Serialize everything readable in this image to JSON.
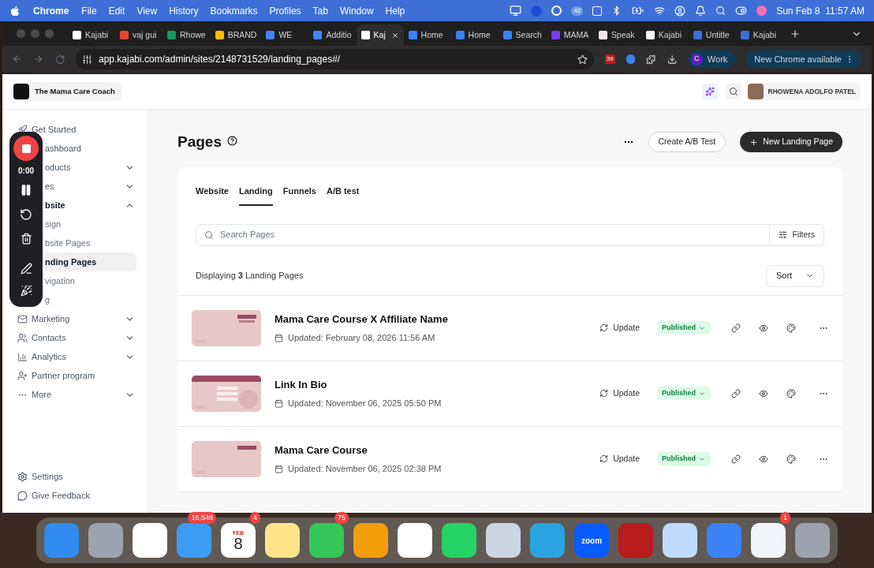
{
  "menu_bar": {
    "app": "Chrome",
    "items": [
      "File",
      "Edit",
      "View",
      "History",
      "Bookmarks",
      "Profiles",
      "Tab",
      "Window",
      "Help"
    ],
    "status_badge": "42",
    "clock": "Sun Feb 8  11:57 AM"
  },
  "browser": {
    "tabs": [
      {
        "label": "Kajabi",
        "color": "#ffffff",
        "selected": false
      },
      {
        "label": "vaj gui",
        "color": "#ea4335",
        "selected": false
      },
      {
        "label": "Rhowe",
        "color": "#0f9d58",
        "selected": false
      },
      {
        "label": "BRAND",
        "color": "#fbbc04",
        "selected": false
      },
      {
        "label": "WE",
        "color": "#4285f4",
        "selected": false
      },
      {
        "label": "Additio",
        "color": "#4285f4",
        "selected": false
      },
      {
        "label": "Kaj",
        "color": "#ffffff",
        "selected": true
      },
      {
        "label": "Home",
        "color": "#3b82f6",
        "selected": false
      },
      {
        "label": "Home",
        "color": "#3b82f6",
        "selected": false
      },
      {
        "label": "Search",
        "color": "#3b82f6",
        "selected": false
      },
      {
        "label": "MAMA",
        "color": "#7c3aed",
        "selected": false
      },
      {
        "label": "Speak",
        "color": "#f3e8e8",
        "selected": false
      },
      {
        "label": "Kajabi",
        "color": "#ffffff",
        "selected": false
      },
      {
        "label": "Untitle",
        "color": "#3b6fd8",
        "selected": false
      },
      {
        "label": "Kajabi",
        "color": "#3b6fd8",
        "selected": false
      }
    ],
    "url": "app.kajabi.com/admin/sites/2148731529/landing_pages#/",
    "extension_badge": "39",
    "profile_initial": "C",
    "profile": "Work",
    "update_notice": "New Chrome available"
  },
  "app": {
    "site_name": "The Mama Care Coach",
    "user": "RHOWENA ADOLFO PATEL",
    "sidebar": {
      "items": [
        {
          "label": "Get Started",
          "kind": "full"
        },
        {
          "label": "ashboard",
          "kind": "covered"
        },
        {
          "label": "oducts",
          "kind": "covered",
          "expanded": false
        },
        {
          "label": "es",
          "kind": "covered",
          "expanded": false
        },
        {
          "label": "bsite",
          "kind": "covered",
          "expanded": true,
          "children": [
            {
              "label": "sign",
              "selected": false
            },
            {
              "label": "bsite Pages",
              "selected": false
            },
            {
              "label": "nding Pages",
              "selected": true
            },
            {
              "label": "vigation",
              "selected": false
            },
            {
              "label": "g",
              "selected": false
            }
          ]
        },
        {
          "label": "Marketing",
          "kind": "full",
          "expanded": false
        },
        {
          "label": "Contacts",
          "kind": "full",
          "expanded": false
        },
        {
          "label": "Analytics",
          "kind": "full",
          "expanded": false
        },
        {
          "label": "Partner program",
          "kind": "full"
        },
        {
          "label": "More",
          "kind": "full",
          "expanded": false
        }
      ],
      "footer": [
        "Settings",
        "Give Feedback"
      ]
    },
    "recorder": {
      "time": "0:00"
    },
    "page": {
      "title": "Pages",
      "buttons": {
        "ab_test": "Create A/B Test",
        "new": "New Landing Page"
      },
      "tabs": [
        {
          "label": "Website",
          "selected": false
        },
        {
          "label": "Landing",
          "selected": true
        },
        {
          "label": "Funnels",
          "selected": false
        },
        {
          "label": "A/B test",
          "selected": false
        }
      ],
      "search": {
        "placeholder": "Search Pages"
      },
      "filters": "Filters",
      "count": "Displaying **3** Landing Pages",
      "sort": "Sort",
      "rows": [
        {
          "title": "Mama Care Course X Affiliate Name",
          "updated": "Updated: February 08, 2026 11:56 AM",
          "action": "Update",
          "status": "Published"
        },
        {
          "title": "Link In Bio",
          "updated": "Updated: November 06, 2025 05:50 PM",
          "action": "Update",
          "status": "Published"
        },
        {
          "title": "Mama Care Course",
          "updated": "Updated: November 06, 2025 02:38 PM",
          "action": "Update",
          "status": "Published"
        }
      ]
    }
  },
  "dock": [
    {
      "color": "#2f8cf0"
    },
    {
      "color": "#9ca3af"
    },
    {
      "color": "#ffffff"
    },
    {
      "color": "#3b9cf5",
      "badge": "15,548"
    },
    {
      "color": "#ffffff",
      "badge": "4",
      "month": "FEB",
      "day": "8"
    },
    {
      "color": "#fde68a"
    },
    {
      "color": "#34c759",
      "badge": "75"
    },
    {
      "color": "#f59e0b"
    },
    {
      "color": "#ffffff"
    },
    {
      "color": "#25d366"
    },
    {
      "color": "#cbd5e1"
    },
    {
      "color": "#2aa3e0"
    },
    {
      "color": "#0b5cff",
      "label": "zoom"
    },
    {
      "color": "#b91c1c"
    },
    {
      "color": "#bfdbfe"
    },
    {
      "color": "#3b82f6"
    },
    {
      "color": "#f1f5f9",
      "badge": "1"
    },
    {
      "color": "#9ca3af"
    }
  ]
}
